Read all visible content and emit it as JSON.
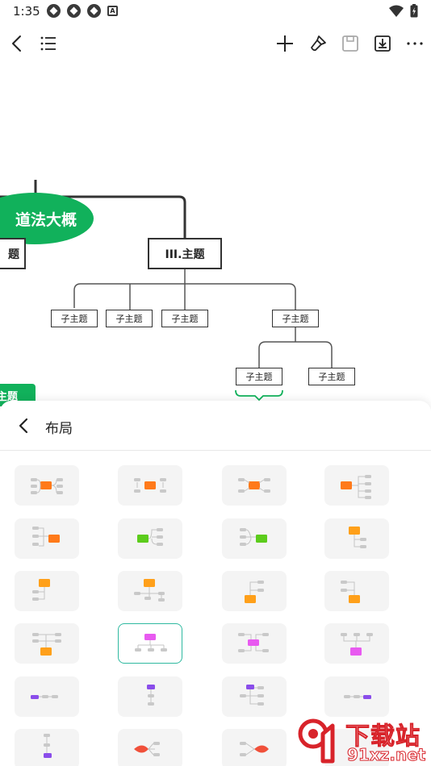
{
  "status_bar": {
    "time": "1:35",
    "left_icons": [
      "app-notification-icon",
      "app-notification-icon",
      "app-notification-icon",
      "a-icon"
    ],
    "a_glyph": "A",
    "right_icons": [
      "wifi-icon",
      "battery-icon"
    ]
  },
  "toolbar": {
    "icons": [
      "back-icon",
      "outline-icon",
      "add-icon",
      "format-brush-icon",
      "save-icon",
      "export-icon",
      "more-icon"
    ]
  },
  "mindmap": {
    "root": "道法大概",
    "left_topic": "题",
    "topic": "III.主题",
    "subtopics": [
      "子主题",
      "子主题",
      "子主题",
      "子主题"
    ],
    "nested_subtopics": [
      "子主题",
      "子主题"
    ],
    "partial_tab": "主题",
    "accent_color": "#11b15b"
  },
  "sheet": {
    "back_label": "back",
    "title": "布局",
    "selected_index": 13,
    "layout_options_count": 24
  },
  "watermark": {
    "top": "下载站",
    "bottom": "91xz.net",
    "color": "#d8232a"
  }
}
